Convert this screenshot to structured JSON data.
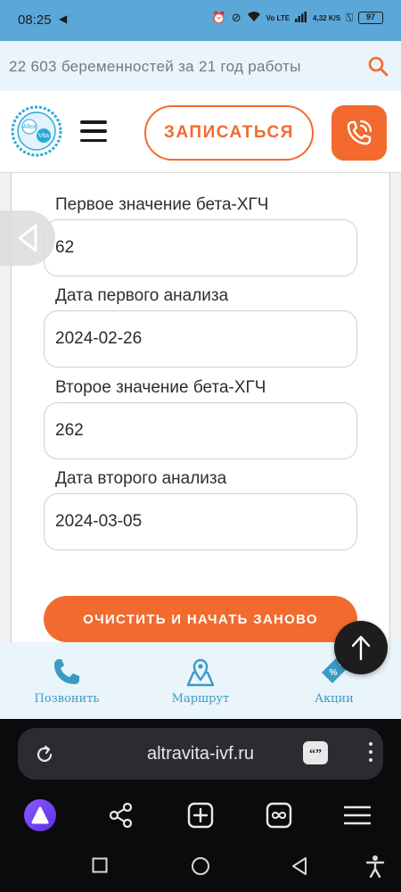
{
  "status_bar": {
    "time": "08:25",
    "network_type": "Vo LTE",
    "speed": "4,32 K/S",
    "battery": "97"
  },
  "site_topbar": {
    "tagline": "22 603 беременностей за 21 год работы",
    "icon": "search-icon"
  },
  "header": {
    "logo_text_top": "Altra",
    "logo_text_bottom": "Vita",
    "signup_label": "ЗАПИСАТЬСЯ",
    "phone_icon": "phone-icon",
    "menu_icon": "hamburger-icon"
  },
  "form": {
    "fields": [
      {
        "label": "Первое значение бета-ХГЧ",
        "value": "62"
      },
      {
        "label": "Дата первого анализа",
        "value": "2024-02-26"
      },
      {
        "label": "Второе значение бета-ХГЧ",
        "value": "262"
      },
      {
        "label": "Дата второго анализа",
        "value": "2024-03-05"
      }
    ],
    "reset_label": "ОЧИСТИТЬ И НАЧАТЬ ЗАНОВО"
  },
  "site_nav": {
    "items": [
      {
        "label": "Позвонить",
        "icon": "phone-icon"
      },
      {
        "label": "Маршрут",
        "icon": "map-route-icon"
      },
      {
        "label": "Акции",
        "icon": "discount-tag-icon"
      }
    ]
  },
  "browser": {
    "url": "altravita-ivf.ru"
  },
  "colors": {
    "accent": "#f26a2e",
    "brand_blue": "#3a9bc4",
    "status_bar": "#5aa7d8",
    "light_panel": "#e9f4fb"
  }
}
